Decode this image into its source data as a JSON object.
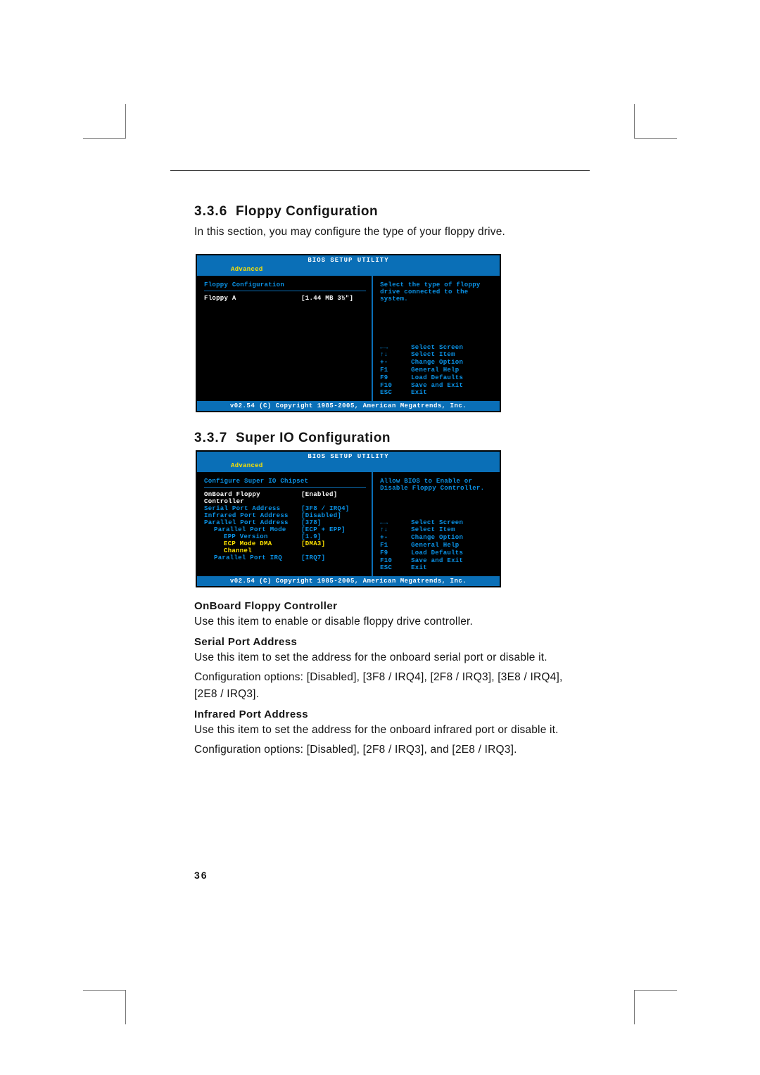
{
  "page_number": "36",
  "section1": {
    "num": "3.3.6",
    "title": "Floppy Configuration",
    "intro": "In this section, you may configure the type of your floppy drive."
  },
  "section2": {
    "num": "3.3.7",
    "title": "Super IO Configuration"
  },
  "bios_common": {
    "title": "BIOS  SETUP  UTILITY",
    "tab": "Advanced",
    "copyright": "v02.54 (C) Copyright 1985-2005, American Megatrends, Inc.",
    "nav": [
      {
        "k": "←→",
        "l": "Select Screen"
      },
      {
        "k": "↑↓",
        "l": "Select Item"
      },
      {
        "k": "+-",
        "l": "Change Option"
      },
      {
        "k": "F1",
        "l": "General Help"
      },
      {
        "k": "F9",
        "l": "Load Defaults"
      },
      {
        "k": "F10",
        "l": "Save and Exit"
      },
      {
        "k": "ESC",
        "l": "Exit"
      }
    ]
  },
  "bios_floppy": {
    "panel_title": "Floppy Configuration",
    "help": "Select the type of floppy drive connected to the system.",
    "rows": [
      {
        "label": "Floppy A",
        "value": "[1.44 MB 3½\"]",
        "color": "white"
      }
    ]
  },
  "bios_superio": {
    "panel_title": "Configure Super IO Chipset",
    "help": "Allow BIOS to Enable or Disable Floppy Controller.",
    "rows": [
      {
        "label": "OnBoard Floppy Controller",
        "value": "[Enabled]",
        "color": "white",
        "indent": 0
      },
      {
        "label": "Serial Port Address",
        "value": "[3F8 / IRQ4]",
        "color": "blue",
        "indent": 0
      },
      {
        "label": "Infrared Port Address",
        "value": "[Disabled]",
        "color": "blue",
        "indent": 0
      },
      {
        "label": "Parallel Port Address",
        "value": "[378]",
        "color": "blue",
        "indent": 0
      },
      {
        "label": "Parallel Port Mode",
        "value": "[ECP + EPP]",
        "color": "blue",
        "indent": 1
      },
      {
        "label": "EPP Version",
        "value": "[1.9]",
        "color": "blue",
        "indent": 2
      },
      {
        "label": "ECP Mode DMA Channel",
        "value": "[DMA3]",
        "color": "yellow",
        "indent": 2
      },
      {
        "label": "Parallel Port IRQ",
        "value": "[IRQ7]",
        "color": "blue",
        "indent": 1
      }
    ]
  },
  "paras": {
    "p1_h": "OnBoard Floppy Controller",
    "p1_b": "Use this item to enable or disable floppy drive controller.",
    "p2_h": "Serial Port Address",
    "p2_b1": "Use this item to set the address for the onboard serial port or disable it.",
    "p2_b2": "Configuration options: [Disabled], [3F8 / IRQ4], [2F8 / IRQ3], [3E8 / IRQ4], [2E8 / IRQ3].",
    "p3_h": "Infrared Port Address",
    "p3_b1": "Use this item to set the address for the onboard infrared port or disable it.",
    "p3_b2": "Configuration options: [Disabled], [2F8 / IRQ3], and [2E8 / IRQ3]."
  }
}
